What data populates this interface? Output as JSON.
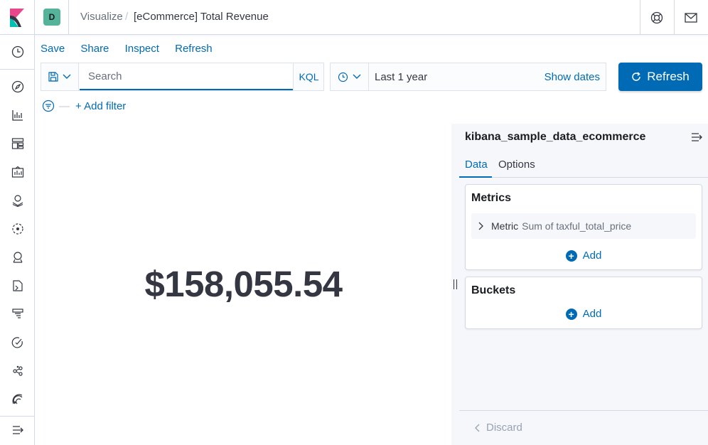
{
  "header": {
    "space_letter": "D",
    "breadcrumbs": [
      "Visualize",
      "[eCommerce] Total Revenue"
    ],
    "separator": "/"
  },
  "menu": {
    "save": "Save",
    "share": "Share",
    "inspect": "Inspect",
    "refresh": "Refresh"
  },
  "query": {
    "placeholder": "Search",
    "language": "KQL"
  },
  "date": {
    "range": "Last 1 year",
    "show_dates": "Show dates"
  },
  "refresh_button": "Refresh",
  "filter": {
    "add": "+ Add filter",
    "dash": "—"
  },
  "visualization": {
    "metric_value": "$158,055.54"
  },
  "sidebar": {
    "index_pattern": "kibana_sample_data_ecommerce",
    "tabs": [
      "Data",
      "Options"
    ],
    "metrics": {
      "title": "Metrics",
      "item_label": "Metric",
      "item_value": "Sum of taxful_total_price",
      "add": "Add"
    },
    "buckets": {
      "title": "Buckets",
      "add": "Add"
    },
    "discard": "Discard"
  },
  "colors": {
    "primary": "#006bb4",
    "space_avatar": "#54b399"
  }
}
